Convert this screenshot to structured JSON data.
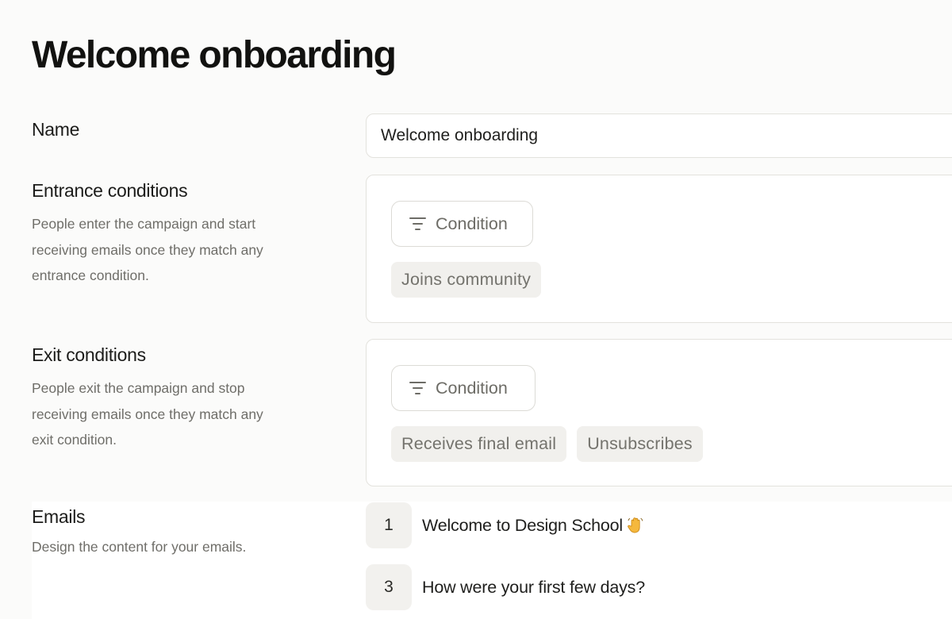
{
  "page": {
    "title": "Welcome onboarding"
  },
  "name_section": {
    "label": "Name",
    "input_value": "Welcome onboarding"
  },
  "entrance": {
    "label": "Entrance conditions",
    "description": "People enter the campaign and start receiving emails once they match any entrance condition.",
    "button_label": "Condition",
    "button_icon": "filter-icon",
    "chips": [
      "Joins community"
    ]
  },
  "exit": {
    "label": "Exit conditions",
    "description": "People exit the campaign and stop receiving emails once they match any exit condition.",
    "button_label": "Condition",
    "button_icon": "filter-icon",
    "chips": [
      "Receives final email",
      "Unsubscribes"
    ]
  },
  "emails": {
    "label": "Emails",
    "description": "Design the content for your emails.",
    "items": [
      {
        "number": "1",
        "title": "Welcome to Design School",
        "icon": "waving-hand-icon"
      },
      {
        "number": "3",
        "title": "How were your first few days?"
      }
    ]
  },
  "colors": {
    "background": "#fbfbfa",
    "border": "#e3e2dd",
    "chip_bg": "#f1f0ed",
    "muted_text": "#6f6e69"
  }
}
